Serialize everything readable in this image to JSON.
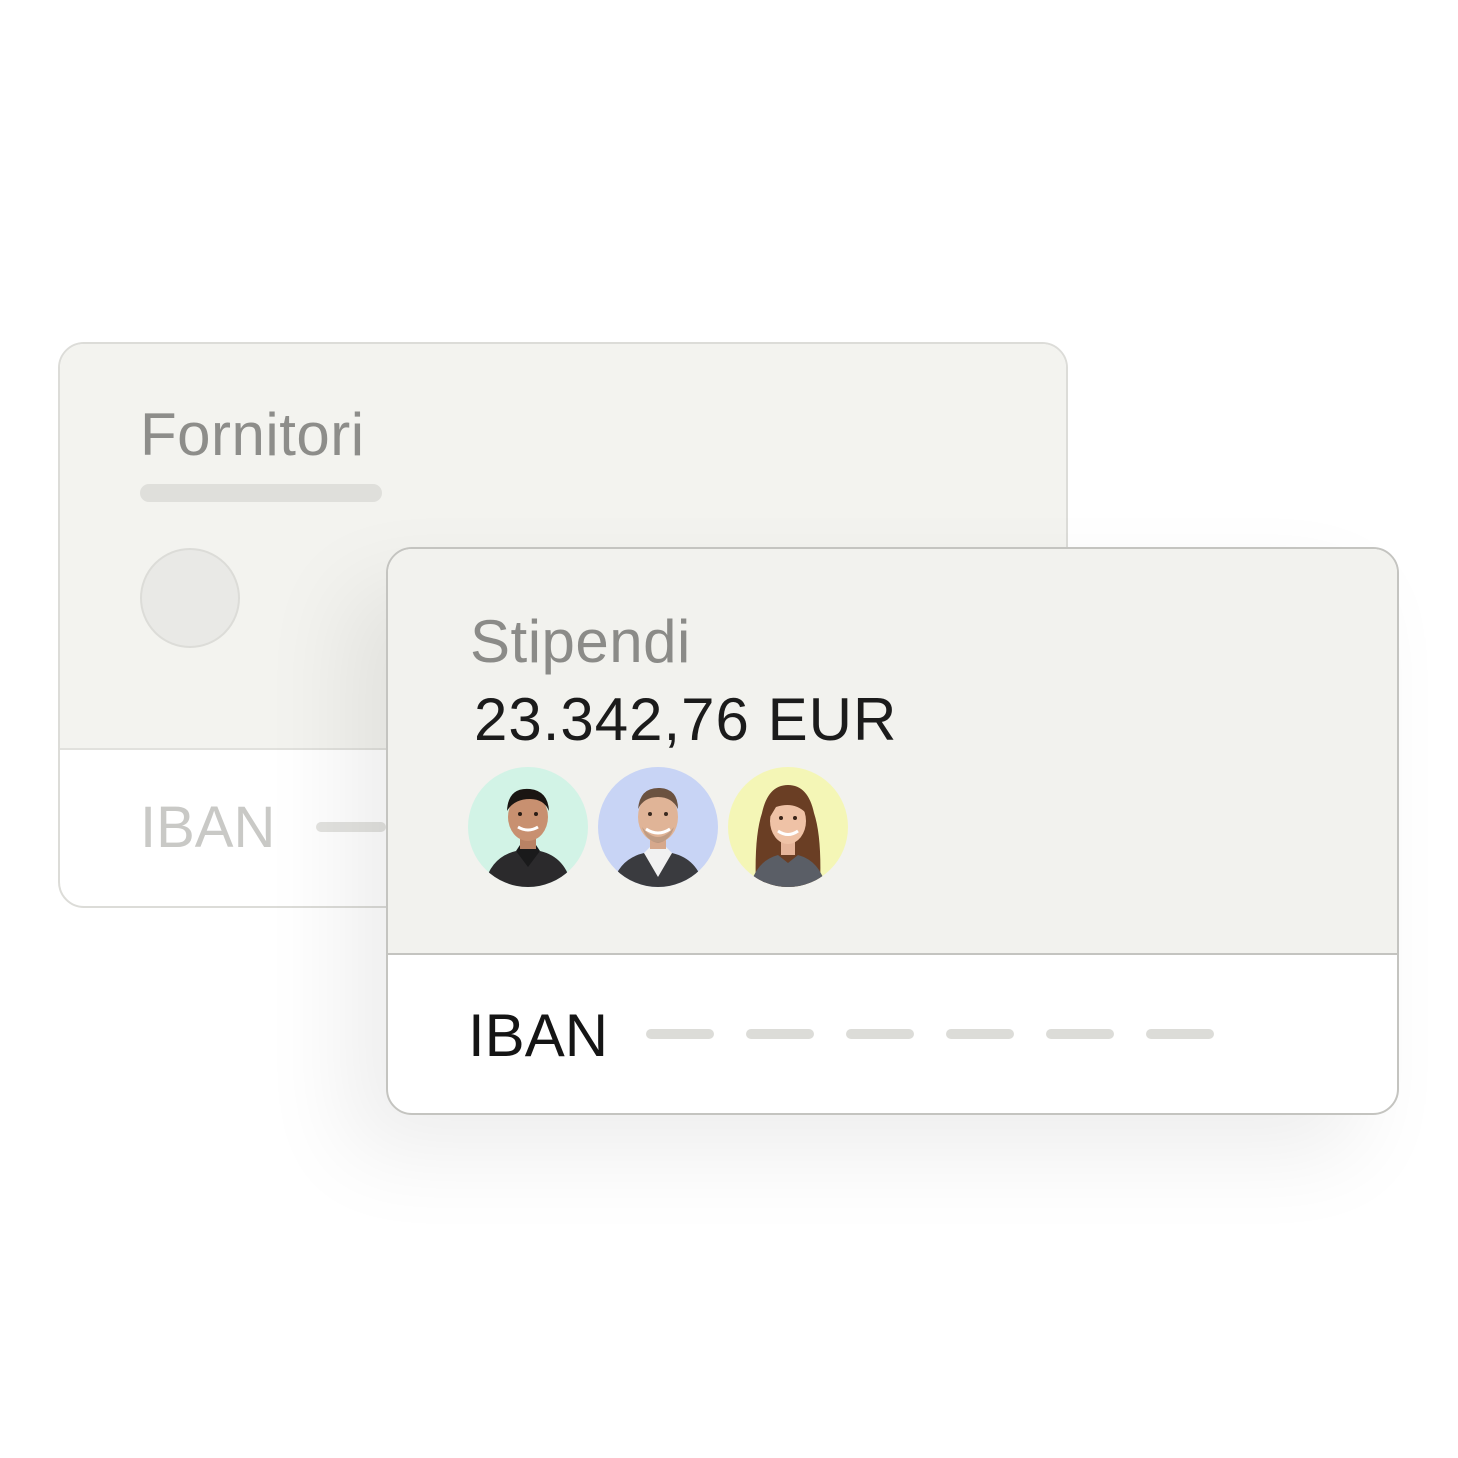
{
  "back_card": {
    "title": "Fornitori",
    "iban_label": "IBAN"
  },
  "front_card": {
    "title": "Stipendi",
    "amount": "23.342,76 EUR",
    "iban_label": "IBAN",
    "avatars": [
      {
        "name": "avatar-man-1",
        "bg_color": "#d2f3e6"
      },
      {
        "name": "avatar-man-2",
        "bg_color": "#c8d4f5"
      },
      {
        "name": "avatar-woman",
        "bg_color": "#f4f6b6"
      }
    ]
  },
  "colors": {
    "card_bg": "#f2f2ee",
    "border": "#c4c4c0",
    "text_dark": "#151515",
    "text_muted": "#8b8b88"
  }
}
